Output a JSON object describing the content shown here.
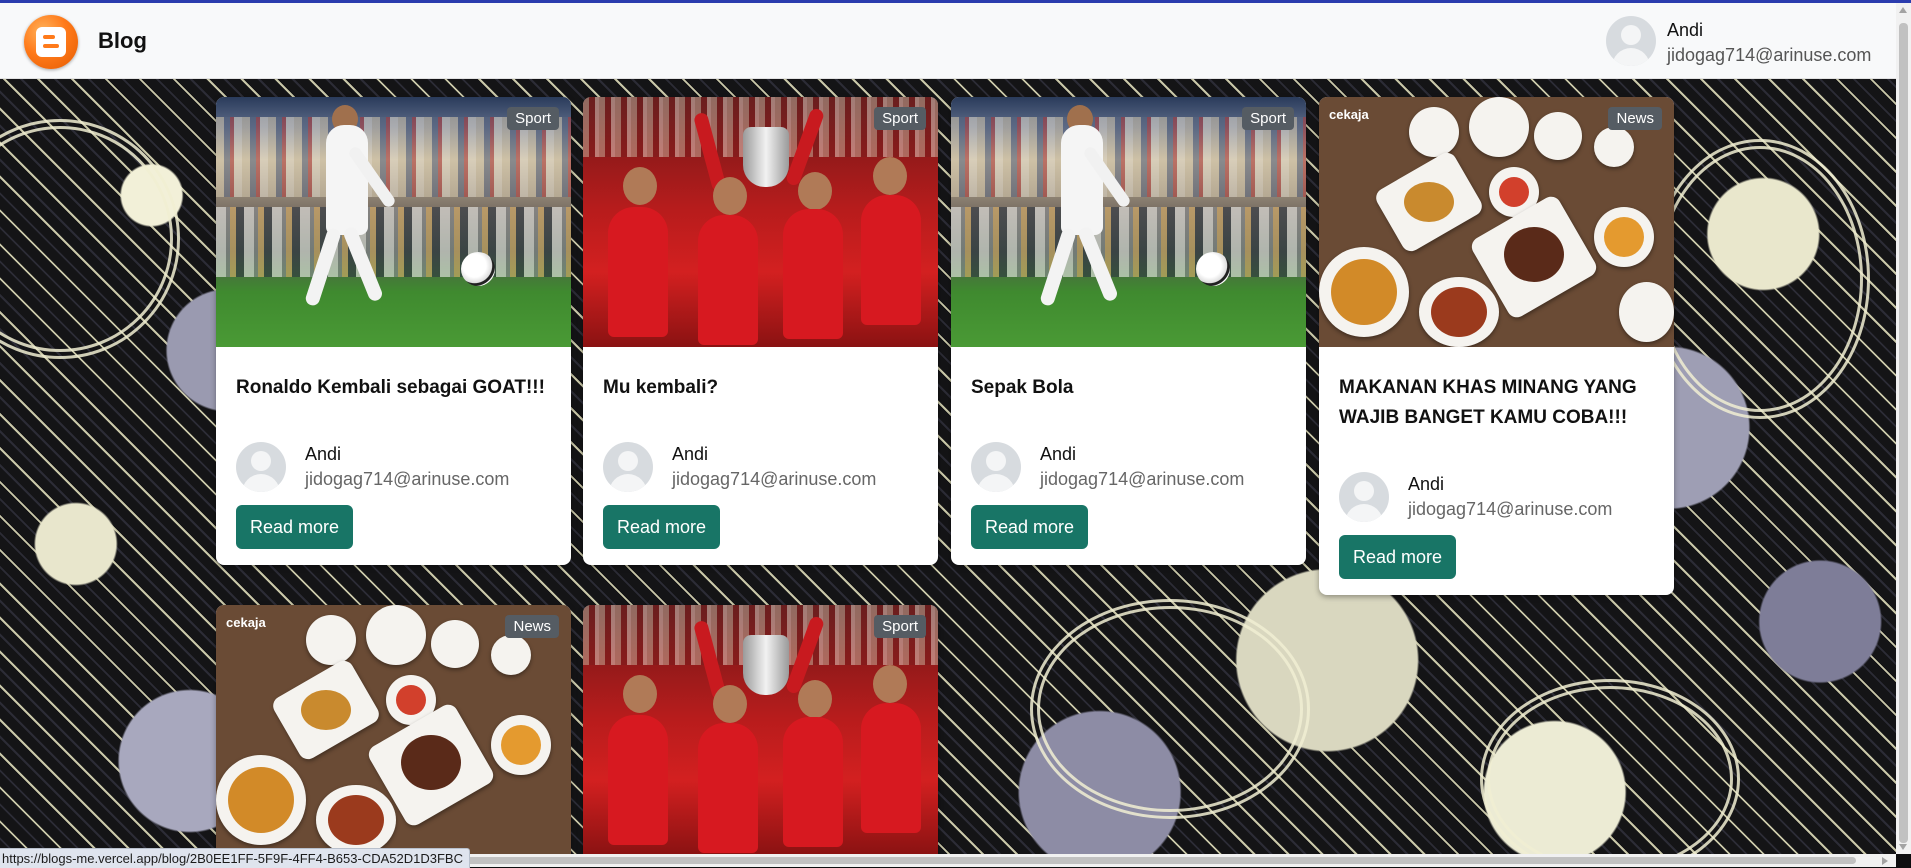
{
  "header": {
    "brand": "Blog",
    "user": {
      "name": "Andi",
      "email": "jidogag714@arinuse.com"
    }
  },
  "cards": [
    {
      "category": "Sport",
      "title": "Ronaldo Kembali sebagai GOAT!!!",
      "author": "Andi",
      "email": "jidogag714@arinuse.com",
      "button": "Read more",
      "image": "soccer-player-photo"
    },
    {
      "category": "Sport",
      "title": "Mu kembali?",
      "author": "Andi",
      "email": "jidogag714@arinuse.com",
      "button": "Read more",
      "image": "team-celebration-photo"
    },
    {
      "category": "Sport",
      "title": "Sepak Bola",
      "author": "Andi",
      "email": "jidogag714@arinuse.com",
      "button": "Read more",
      "image": "soccer-player-photo"
    },
    {
      "category": "News",
      "title": "MAKANAN KHAS MINANG YANG WAJIB BANGET KAMU COBA!!!",
      "author": "Andi",
      "email": "jidogag714@arinuse.com",
      "button": "Read more",
      "image": "food-table-photo",
      "image_watermark": "cekaja"
    },
    {
      "category": "News",
      "image": "food-table-photo",
      "image_watermark": "cekaja"
    },
    {
      "category": "Sport",
      "image": "team-celebration-photo"
    }
  ],
  "status_url": "https://blogs-me.vercel.app/blog/2B0EE1FF-5F9F-4FF4-B653-CDA52D1D3FBC",
  "colors": {
    "button": "#187566",
    "badge": "#555c63",
    "top_accent": "#2b3cae"
  }
}
